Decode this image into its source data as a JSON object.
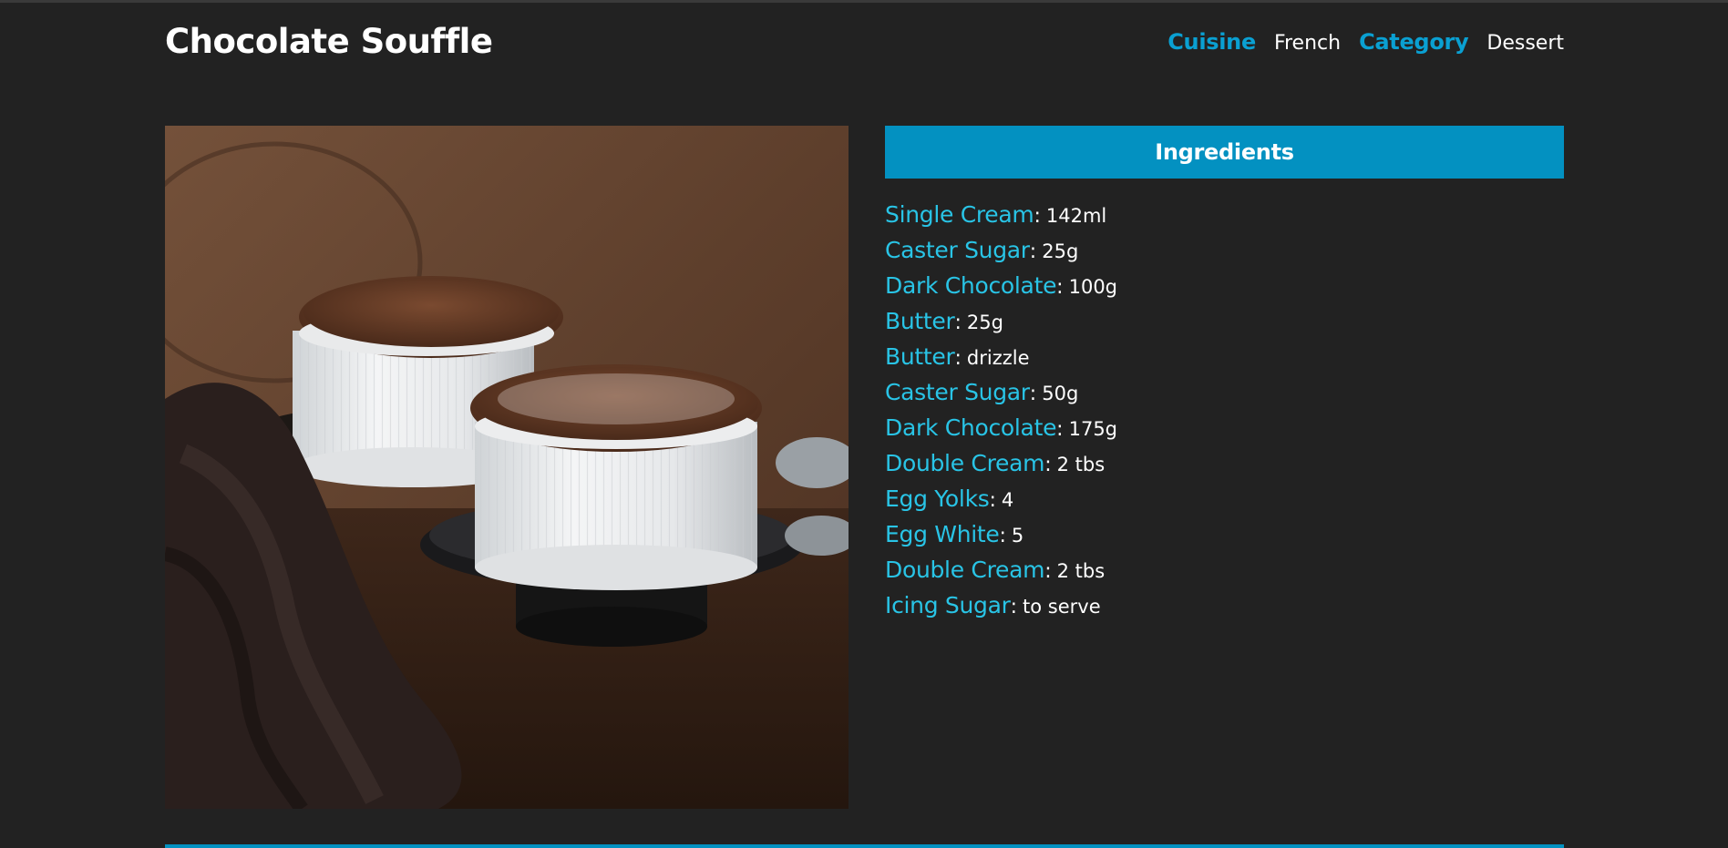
{
  "meal": {
    "title": "Chocolate Souffle",
    "cuisine_label": "Cuisine",
    "cuisine_value": "French",
    "category_label": "Category",
    "category_value": "Dessert"
  },
  "photo": {
    "icon": "meal-photo"
  },
  "ingredients": {
    "heading": "Ingredients",
    "separator": ":",
    "items": [
      {
        "name": "Single Cream",
        "measure": "142ml"
      },
      {
        "name": "Caster Sugar",
        "measure": "25g"
      },
      {
        "name": "Dark Chocolate",
        "measure": "100g"
      },
      {
        "name": "Butter",
        "measure": "25g"
      },
      {
        "name": "Butter",
        "measure": "drizzle"
      },
      {
        "name": "Caster Sugar",
        "measure": "50g"
      },
      {
        "name": "Dark Chocolate",
        "measure": "175g"
      },
      {
        "name": "Double Cream",
        "measure": "2 tbs"
      },
      {
        "name": "Egg Yolks",
        "measure": "4"
      },
      {
        "name": "Egg White",
        "measure": "5"
      },
      {
        "name": "Double Cream",
        "measure": "2 tbs"
      },
      {
        "name": "Icing Sugar",
        "measure": "to serve"
      }
    ]
  },
  "colors": {
    "background": "#222222",
    "accent": "#0391c1",
    "ingredient_name": "#29c4e6",
    "heading_link": "#0aa0d2"
  }
}
